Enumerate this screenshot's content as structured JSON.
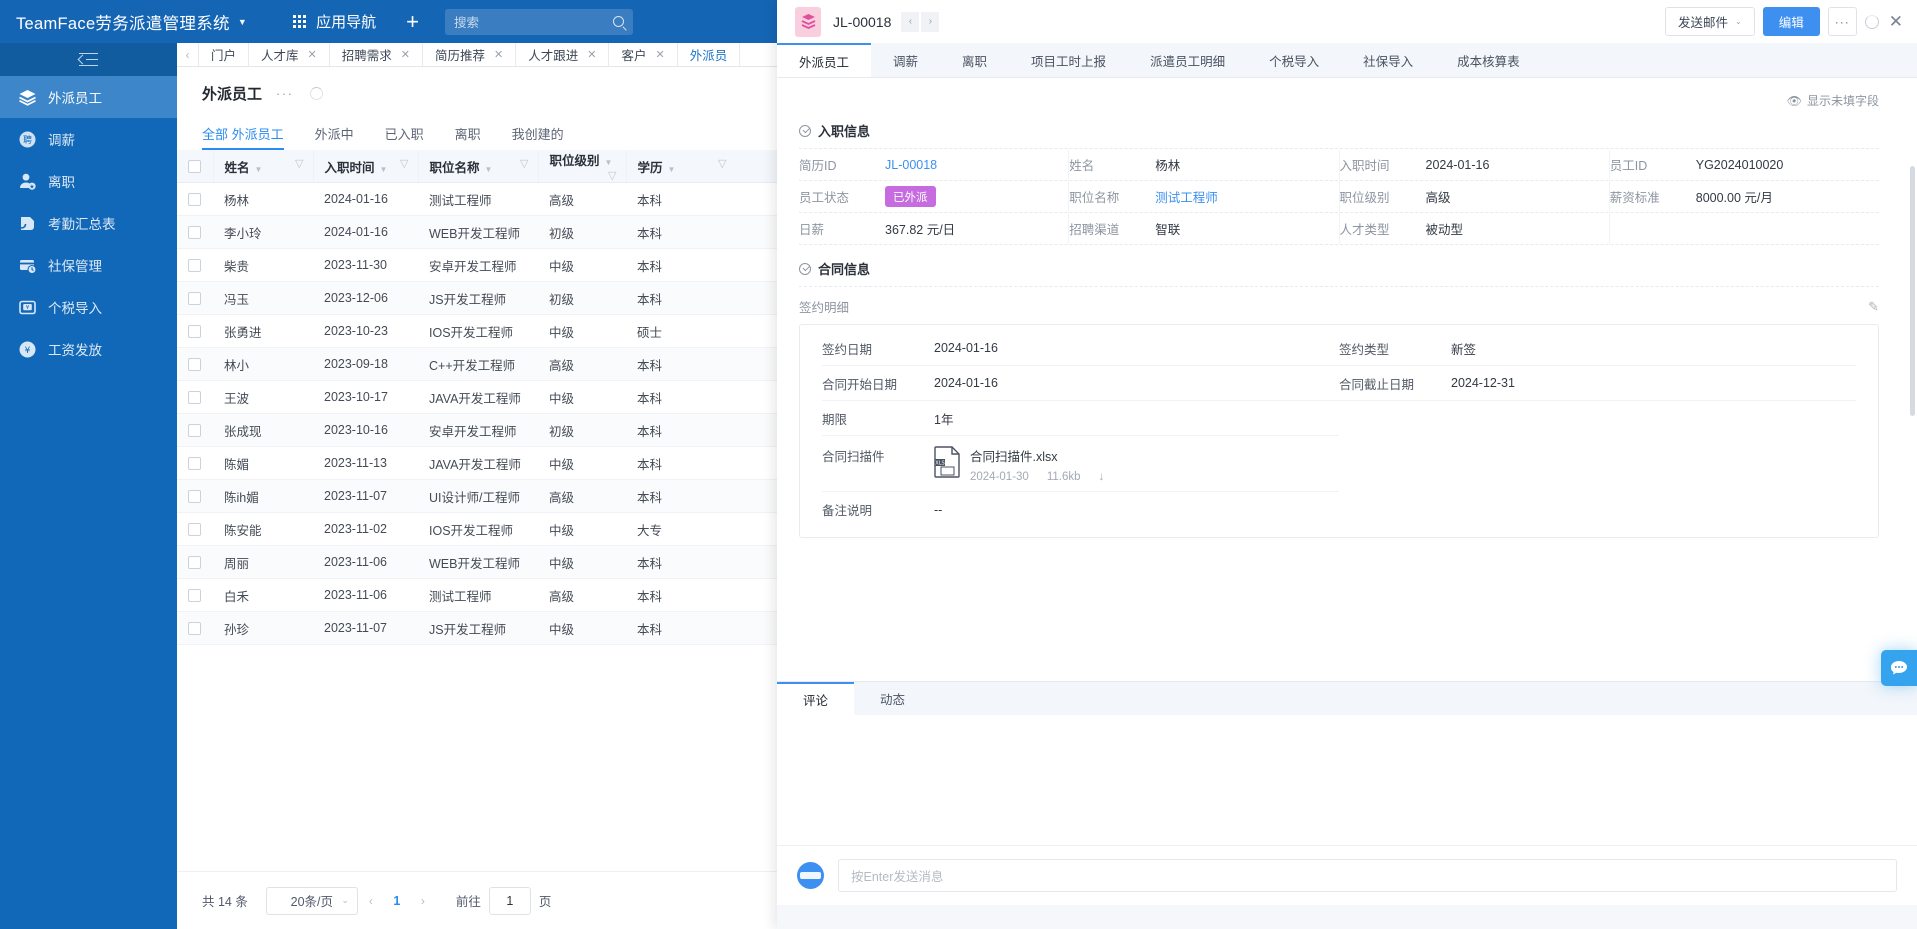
{
  "topbar": {
    "brand": "TeamFace劳务派遣管理系统",
    "caret": "▼",
    "nav_label": "应用导航",
    "plus": "+",
    "search_placeholder": "搜索"
  },
  "sidebar": {
    "items": [
      {
        "label": "外派员工",
        "icon": "layers-icon",
        "active": true
      },
      {
        "label": "调薪",
        "icon": "badge-icon",
        "active": false
      },
      {
        "label": "离职",
        "icon": "user-star-icon",
        "active": false
      },
      {
        "label": "考勤汇总表",
        "icon": "report-icon",
        "active": false
      },
      {
        "label": "社保管理",
        "icon": "card-clock-icon",
        "active": false
      },
      {
        "label": "个税导入",
        "icon": "inbox-yuan-icon",
        "active": false
      },
      {
        "label": "工资发放",
        "icon": "wallet-icon",
        "active": false
      }
    ]
  },
  "browser_tabs": {
    "prev": "‹",
    "items": [
      {
        "label": "门户",
        "closable": false
      },
      {
        "label": "人才库",
        "closable": true
      },
      {
        "label": "招聘需求",
        "closable": true
      },
      {
        "label": "简历推荐",
        "closable": true
      },
      {
        "label": "人才跟进",
        "closable": true
      },
      {
        "label": "客户",
        "closable": true
      },
      {
        "label": "外派员",
        "closable": false
      }
    ]
  },
  "list_pane": {
    "title": "外派员工",
    "more": "···",
    "subtabs": [
      {
        "label": "全部 外派员工",
        "active": true
      },
      {
        "label": "外派中",
        "active": false
      },
      {
        "label": "已入职",
        "active": false
      },
      {
        "label": "离职",
        "active": false
      },
      {
        "label": "我创建的",
        "active": false
      }
    ],
    "columns": [
      "姓名",
      "入职时间",
      "职位名称",
      "职位级别",
      "学历"
    ],
    "rows": [
      {
        "name": "杨林",
        "date": "2024-01-16",
        "position": "测试工程师",
        "level": "高级",
        "edu": "本科"
      },
      {
        "name": "李小玲",
        "date": "2024-01-16",
        "position": "WEB开发工程师",
        "level": "初级",
        "edu": "本科"
      },
      {
        "name": "柴贵",
        "date": "2023-11-30",
        "position": "安卓开发工程师",
        "level": "中级",
        "edu": "本科"
      },
      {
        "name": "冯玉",
        "date": "2023-12-06",
        "position": "JS开发工程师",
        "level": "初级",
        "edu": "本科"
      },
      {
        "name": "张勇进",
        "date": "2023-10-23",
        "position": "IOS开发工程师",
        "level": "中级",
        "edu": "硕士"
      },
      {
        "name": "林小",
        "date": "2023-09-18",
        "position": "C++开发工程师",
        "level": "高级",
        "edu": "本科"
      },
      {
        "name": "王波",
        "date": "2023-10-17",
        "position": "JAVA开发工程师",
        "level": "中级",
        "edu": "本科"
      },
      {
        "name": "张成现",
        "date": "2023-10-16",
        "position": "安卓开发工程师",
        "level": "初级",
        "edu": "本科"
      },
      {
        "name": "陈媚",
        "date": "2023-11-13",
        "position": "JAVA开发工程师",
        "level": "中级",
        "edu": "本科"
      },
      {
        "name": "陈ih媚",
        "date": "2023-11-07",
        "position": "UI设计师/工程师",
        "level": "高级",
        "edu": "本科"
      },
      {
        "name": "陈安能",
        "date": "2023-11-02",
        "position": "IOS开发工程师",
        "level": "中级",
        "edu": "大专"
      },
      {
        "name": "周丽",
        "date": "2023-11-06",
        "position": "WEB开发工程师",
        "level": "中级",
        "edu": "本科"
      },
      {
        "name": "白禾",
        "date": "2023-11-06",
        "position": "测试工程师",
        "level": "高级",
        "edu": "本科"
      },
      {
        "name": "孙珍",
        "date": "2023-11-07",
        "position": "JS开发工程师",
        "level": "中级",
        "edu": "本科"
      }
    ],
    "pager": {
      "total": "共 14 条",
      "page_size": "20条/页",
      "prev": "‹",
      "current": "1",
      "next": "›",
      "goto_label": "前往",
      "goto_value": "1",
      "goto_unit": "页"
    }
  },
  "drawer": {
    "record_id": "JL-00018",
    "nav_prev": "‹",
    "nav_next": "›",
    "send_mail": "发送邮件",
    "send_mail_caret": "⌄",
    "edit": "编辑",
    "more": "···",
    "close": "✕",
    "tabs": [
      {
        "label": "外派员工",
        "active": true
      },
      {
        "label": "调薪",
        "active": false
      },
      {
        "label": "离职",
        "active": false
      },
      {
        "label": "项目工时上报",
        "active": false
      },
      {
        "label": "派遣员工明细",
        "active": false
      },
      {
        "label": "个税导入",
        "active": false
      },
      {
        "label": "社保导入",
        "active": false
      },
      {
        "label": "成本核算表",
        "active": false
      }
    ],
    "show_hidden_fields": "显示未填字段",
    "section_onboard": {
      "title": "入职信息",
      "fields": [
        [
          {
            "label": "简历ID",
            "value": "JL-00018",
            "style": "link"
          },
          {
            "label": "姓名",
            "value": "杨林",
            "style": "text"
          },
          {
            "label": "入职时间",
            "value": "2024-01-16",
            "style": "text"
          },
          {
            "label": "员工ID",
            "value": "YG2024010020",
            "style": "text"
          }
        ],
        [
          {
            "label": "员工状态",
            "value": "已外派",
            "style": "tag"
          },
          {
            "label": "职位名称",
            "value": "测试工程师",
            "style": "link"
          },
          {
            "label": "职位级别",
            "value": "高级",
            "style": "text"
          },
          {
            "label": "薪资标准",
            "value": "8000.00 元/月",
            "style": "text"
          }
        ],
        [
          {
            "label": "日薪",
            "value": "367.82 元/日",
            "style": "text"
          },
          {
            "label": "招聘渠道",
            "value": "智联",
            "style": "text"
          },
          {
            "label": "人才类型",
            "value": "被动型",
            "style": "text"
          },
          {
            "label": "",
            "value": "",
            "style": "text"
          }
        ]
      ]
    },
    "section_contract": {
      "title": "合同信息",
      "sub_label": "签约明细",
      "rows": [
        {
          "left_label": "签约日期",
          "left_value": "2024-01-16",
          "right_label": "签约类型",
          "right_value": "新签"
        },
        {
          "left_label": "合同开始日期",
          "left_value": "2024-01-16",
          "right_label": "合同截止日期",
          "right_value": "2024-12-31"
        },
        {
          "left_label": "期限",
          "left_value": "1年",
          "right_label": "",
          "right_value": ""
        }
      ],
      "attachment": {
        "label": "合同扫描件",
        "file_name": "合同扫描件.xlsx",
        "file_date": "2024-01-30",
        "file_size": "11.6kb",
        "download": "↓"
      },
      "remark": {
        "label": "备注说明",
        "value": "--"
      }
    },
    "comments": {
      "tabs": [
        {
          "label": "评论",
          "active": true
        },
        {
          "label": "动态",
          "active": false
        }
      ],
      "input_placeholder": "按Enter发送消息"
    }
  },
  "colors": {
    "brand_blue": "#1565b5",
    "sidebar_blue": "#1268b8",
    "accent": "#3d90f0",
    "tag_purple": "#c66ce0"
  }
}
